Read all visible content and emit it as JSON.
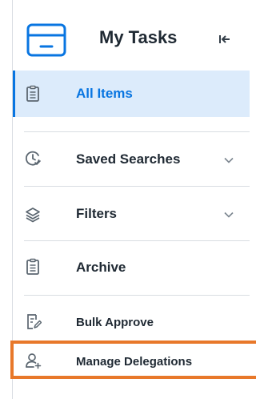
{
  "header": {
    "title": "My Tasks",
    "icons": {
      "app": "inbox-tray-icon",
      "collapse": "collapse-left-icon"
    }
  },
  "menu": {
    "all_items": {
      "label": "All Items",
      "icon": "clipboard-icon",
      "active": true
    },
    "saved_searches": {
      "label": "Saved Searches",
      "icon": "clock-search-icon"
    },
    "filters": {
      "label": "Filters",
      "icon": "layers-icon"
    },
    "archive": {
      "label": "Archive",
      "icon": "clipboard-icon"
    },
    "bulk_approve": {
      "label": "Bulk Approve",
      "icon": "document-edit-icon"
    },
    "manage_delegations": {
      "label": "Manage Delegations",
      "icon": "person-add-icon"
    }
  },
  "colors": {
    "accent": "#0875e1",
    "active_bg": "#dcebfb",
    "highlight": "#e8782a",
    "text": "#1f2933",
    "icon": "#5b6670",
    "divider": "#d9dde2"
  }
}
